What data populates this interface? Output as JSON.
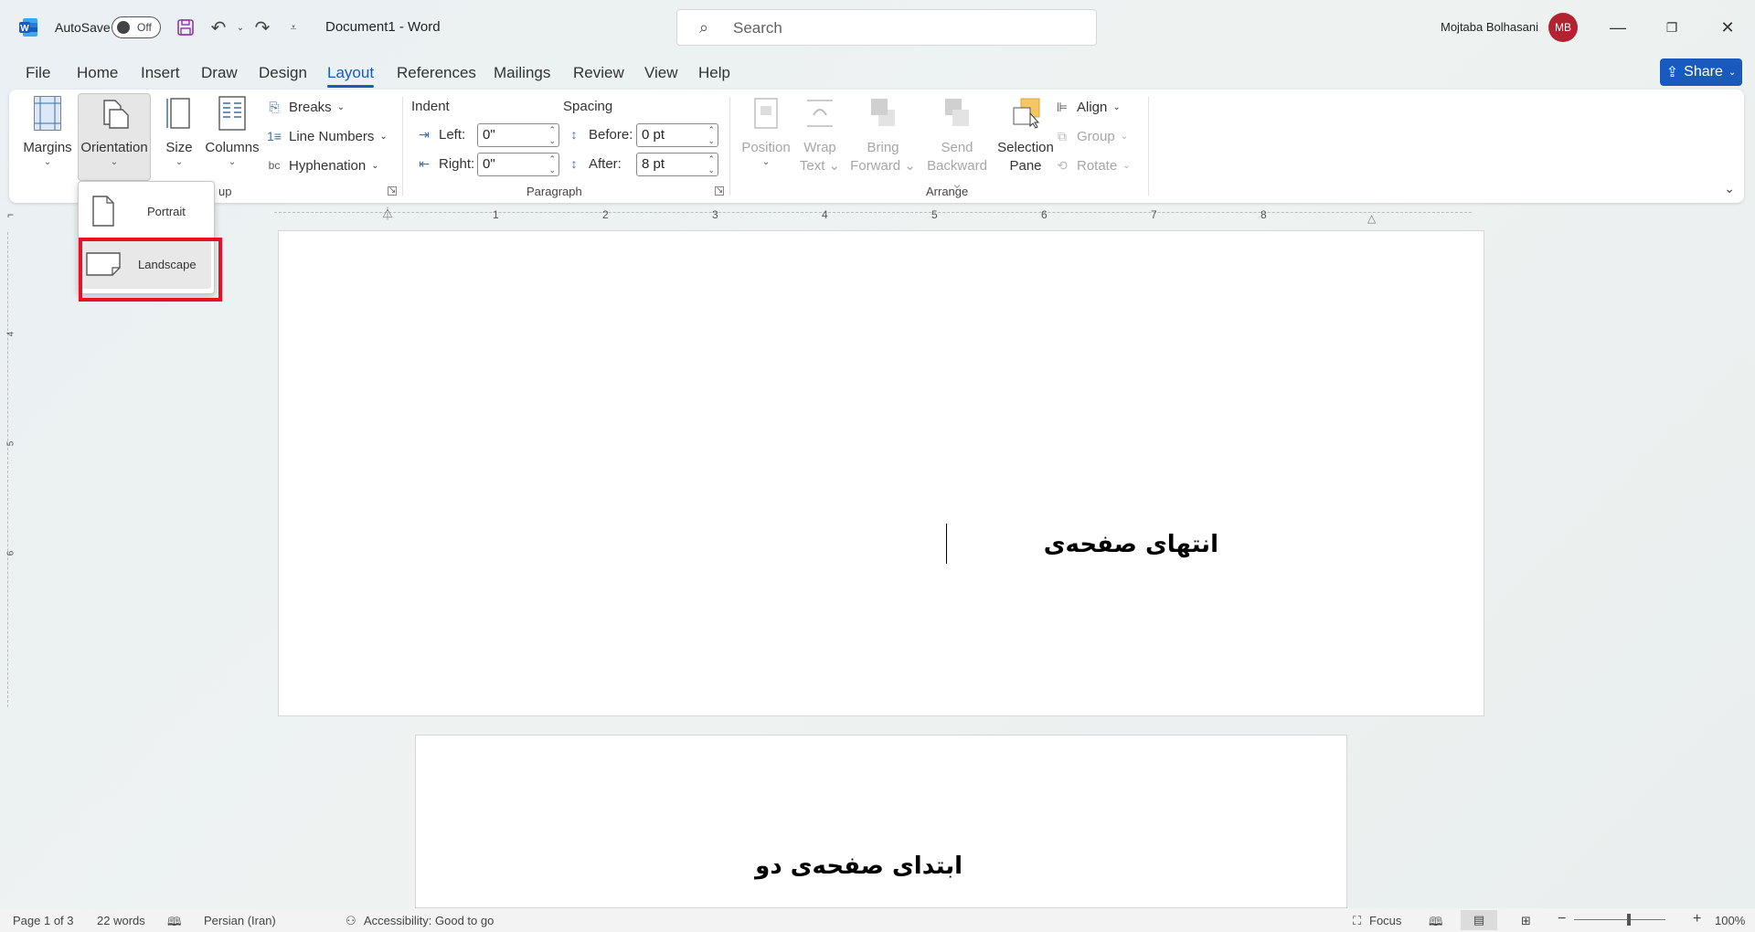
{
  "titlebar": {
    "autosave_label": "AutoSave",
    "autosave_state": "Off",
    "document_title": "Document1  -  Word",
    "search_placeholder": "Search",
    "user_name": "Mojtaba Bolhasani",
    "user_initials": "MB"
  },
  "tabs": [
    "File",
    "Home",
    "Insert",
    "Draw",
    "Design",
    "Layout",
    "References",
    "Mailings",
    "Review",
    "View",
    "Help"
  ],
  "active_tab": "Layout",
  "share_label": "Share",
  "ribbon": {
    "page_setup": {
      "margins": "Margins",
      "orientation": "Orientation",
      "size": "Size",
      "columns": "Columns",
      "breaks": "Breaks",
      "line_numbers": "Line Numbers",
      "hyphenation": "Hyphenation",
      "group_label_partial": "up"
    },
    "paragraph": {
      "indent_label": "Indent",
      "spacing_label": "Spacing",
      "left_label": "Left:",
      "left_value": "0\"",
      "right_label": "Right:",
      "right_value": "0\"",
      "before_label": "Before:",
      "before_value": "0 pt",
      "after_label": "After:",
      "after_value": "8 pt",
      "group_label": "Paragraph"
    },
    "arrange": {
      "position": "Position",
      "wrap_text_1": "Wrap",
      "wrap_text_2": "Text",
      "bring_forward_1": "Bring",
      "bring_forward_2": "Forward",
      "send_backward_1": "Send",
      "send_backward_2": "Backward",
      "selection_pane_1": "Selection",
      "selection_pane_2": "Pane",
      "align": "Align",
      "group": "Group",
      "rotate": "Rotate",
      "group_label": "Arrange"
    }
  },
  "orientation_menu": {
    "portrait": "Portrait",
    "landscape": "Landscape"
  },
  "ruler": {
    "numbers": [
      "1",
      "2",
      "3",
      "4",
      "5",
      "6",
      "7",
      "8"
    ],
    "vnumbers": [
      "4",
      "5",
      "6"
    ]
  },
  "document": {
    "page1_text": "انتهای صفحه‌ی",
    "page2_text": "ابتدای صفحه‌ی دو"
  },
  "statusbar": {
    "page": "Page 1 of 3",
    "words": "22 words",
    "language": "Persian (Iran)",
    "accessibility": "Accessibility: Good to go",
    "focus": "Focus",
    "zoom": "100%"
  },
  "colors": {
    "accent": "#185abd",
    "highlight": "#e81123",
    "avatar": "#b12331"
  }
}
